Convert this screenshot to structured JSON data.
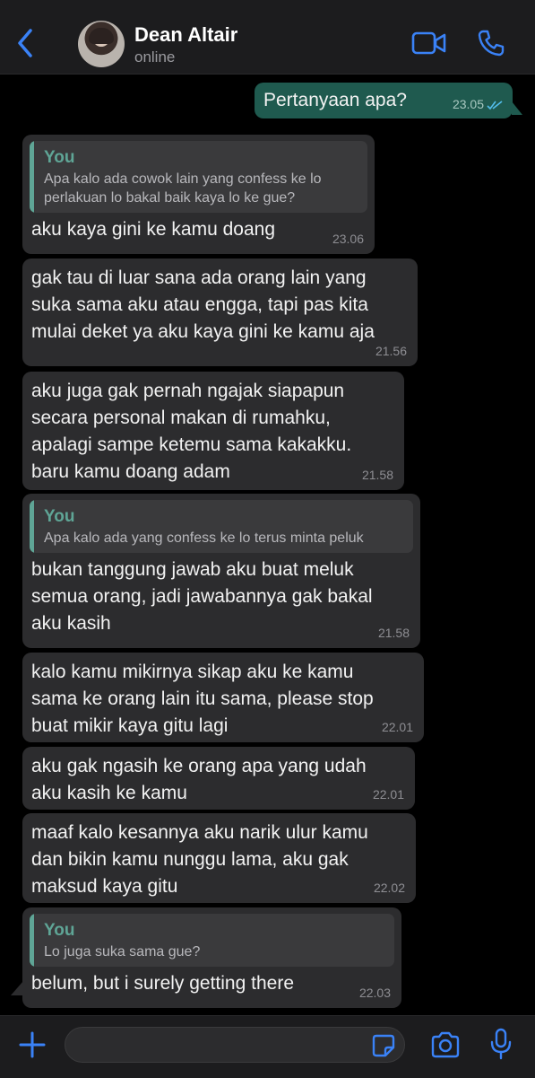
{
  "header": {
    "contact_name": "Dean Altair",
    "status": "online",
    "icons": [
      "back-chevron-icon",
      "video-call-icon",
      "phone-icon"
    ],
    "accent": "#3a82f7"
  },
  "messages": [
    {
      "direction": "out",
      "text": "Pertanyaan apa?",
      "time": "23.05",
      "read": true
    },
    {
      "direction": "in",
      "quote": {
        "author": "You",
        "text": "Apa kalo ada cowok lain yang confess ke lo\nperlakuan lo bakal baik kaya lo ke gue?"
      },
      "text": "aku kaya gini ke kamu doang",
      "time": "23.06"
    },
    {
      "direction": "in",
      "text": "gak tau di luar sana ada orang lain yang\nsuka sama aku atau engga, tapi pas kita\nmulai deket ya aku kaya gini ke kamu aja",
      "time": "21.56"
    },
    {
      "direction": "in",
      "text": "aku juga gak pernah ngajak siapapun\nsecara personal makan di rumahku,\napalagi sampe ketemu sama kakakku.\nbaru kamu doang adam",
      "time": "21.58"
    },
    {
      "direction": "in",
      "quote": {
        "author": "You",
        "text": "Apa kalo ada yang confess ke lo terus minta peluk"
      },
      "text": "bukan tanggung jawab aku buat meluk\nsemua orang, jadi jawabannya gak bakal\naku kasih",
      "time": "21.58"
    },
    {
      "direction": "in",
      "text": "kalo kamu mikirnya sikap aku ke kamu\nsama ke orang lain itu sama, please stop\nbuat mikir kaya gitu lagi",
      "time": "22.01"
    },
    {
      "direction": "in",
      "text": "aku gak ngasih ke orang apa yang udah\naku kasih ke kamu",
      "time": "22.01"
    },
    {
      "direction": "in",
      "text": "maaf kalo kesannya aku narik ulur kamu\ndan bikin kamu nunggu lama, aku gak\nmaksud kaya gitu",
      "time": "22.02"
    },
    {
      "direction": "in",
      "quote": {
        "author": "You",
        "text": "Lo juga suka sama gue?"
      },
      "text": "belum, but i surely getting there",
      "time": "22.03"
    }
  ],
  "composer": {
    "value": "",
    "icons": [
      "plus-icon",
      "sticker-icon",
      "camera-icon",
      "microphone-icon"
    ]
  },
  "colors": {
    "incoming_bubble": "#2c2c2e",
    "outgoing_bubble": "#1f5a4f",
    "quote_accent": "#5fa596",
    "read_ticks": "#53bdeb"
  }
}
